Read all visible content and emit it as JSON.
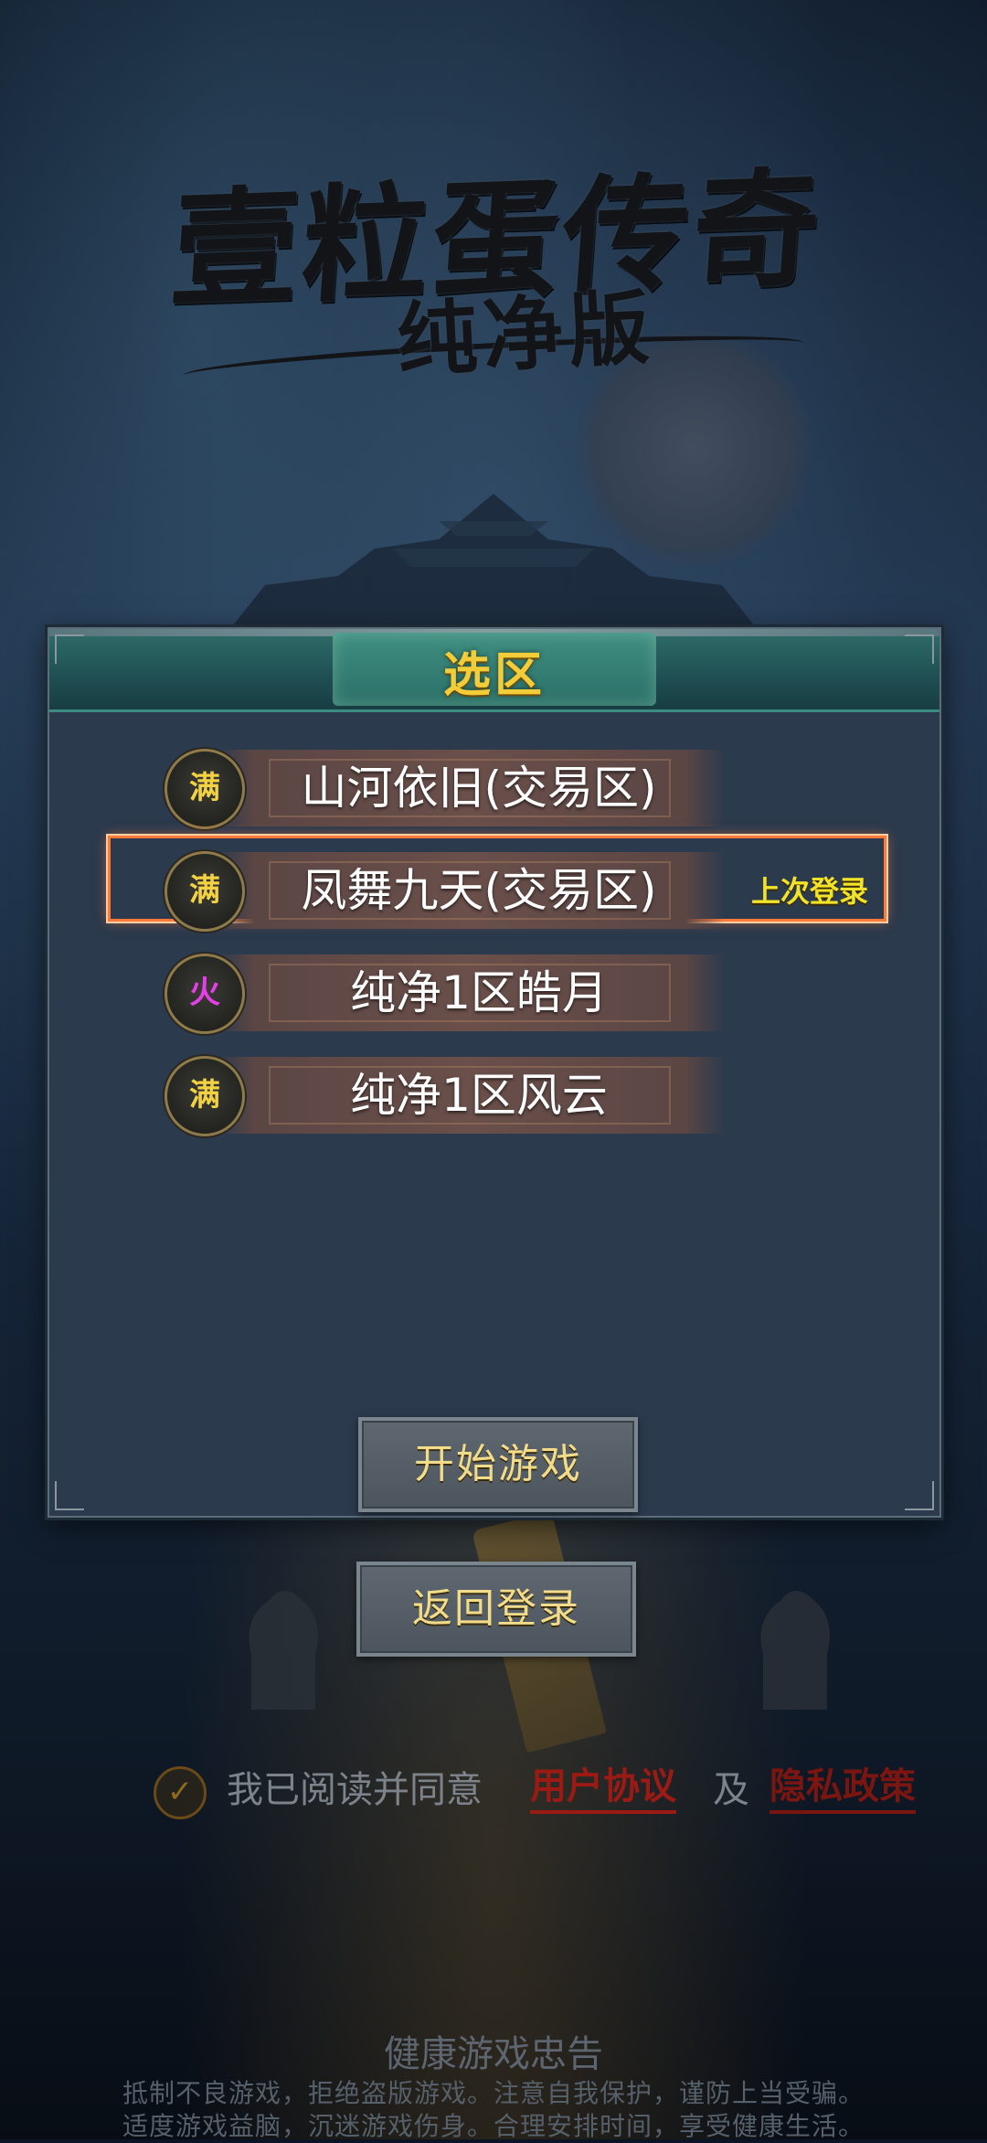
{
  "game": {
    "logo_title": "壹粒蛋传奇",
    "logo_subtitle": "纯净版"
  },
  "server_panel": {
    "title": "选区",
    "servers": [
      {
        "status": "满",
        "status_color": "#f2d242",
        "name": "山河依旧(交易区)",
        "selected": false
      },
      {
        "status": "满",
        "status_color": "#f2d242",
        "name": "凤舞九天(交易区)",
        "selected": true,
        "tag": "上次登录"
      },
      {
        "status": "火",
        "status_color": "#e63fe8",
        "name": "纯净1区皓月",
        "selected": false
      },
      {
        "status": "满",
        "status_color": "#f2d242",
        "name": "纯净1区风云",
        "selected": false
      }
    ],
    "start_button": "开始游戏"
  },
  "back_button": "返回登录",
  "agreement": {
    "checked": true,
    "text": "我已阅读并同意",
    "user_agreement": "用户协议",
    "and": "及",
    "privacy_policy": "隐私政策"
  },
  "health_notice": {
    "title": "健康游戏忠告",
    "line1": "抵制不良游戏，拒绝盗版游戏。注意自我保护，谨防上当受骗。",
    "line2": "适度游戏益脑，沉迷游戏伤身。合理安排时间，享受健康生活。"
  },
  "colors": {
    "title_gold": "#f2cd39",
    "selected_outline": "#ff7a3a",
    "last_login_yellow": "#f2e228",
    "link_red": "#9c1a14"
  }
}
